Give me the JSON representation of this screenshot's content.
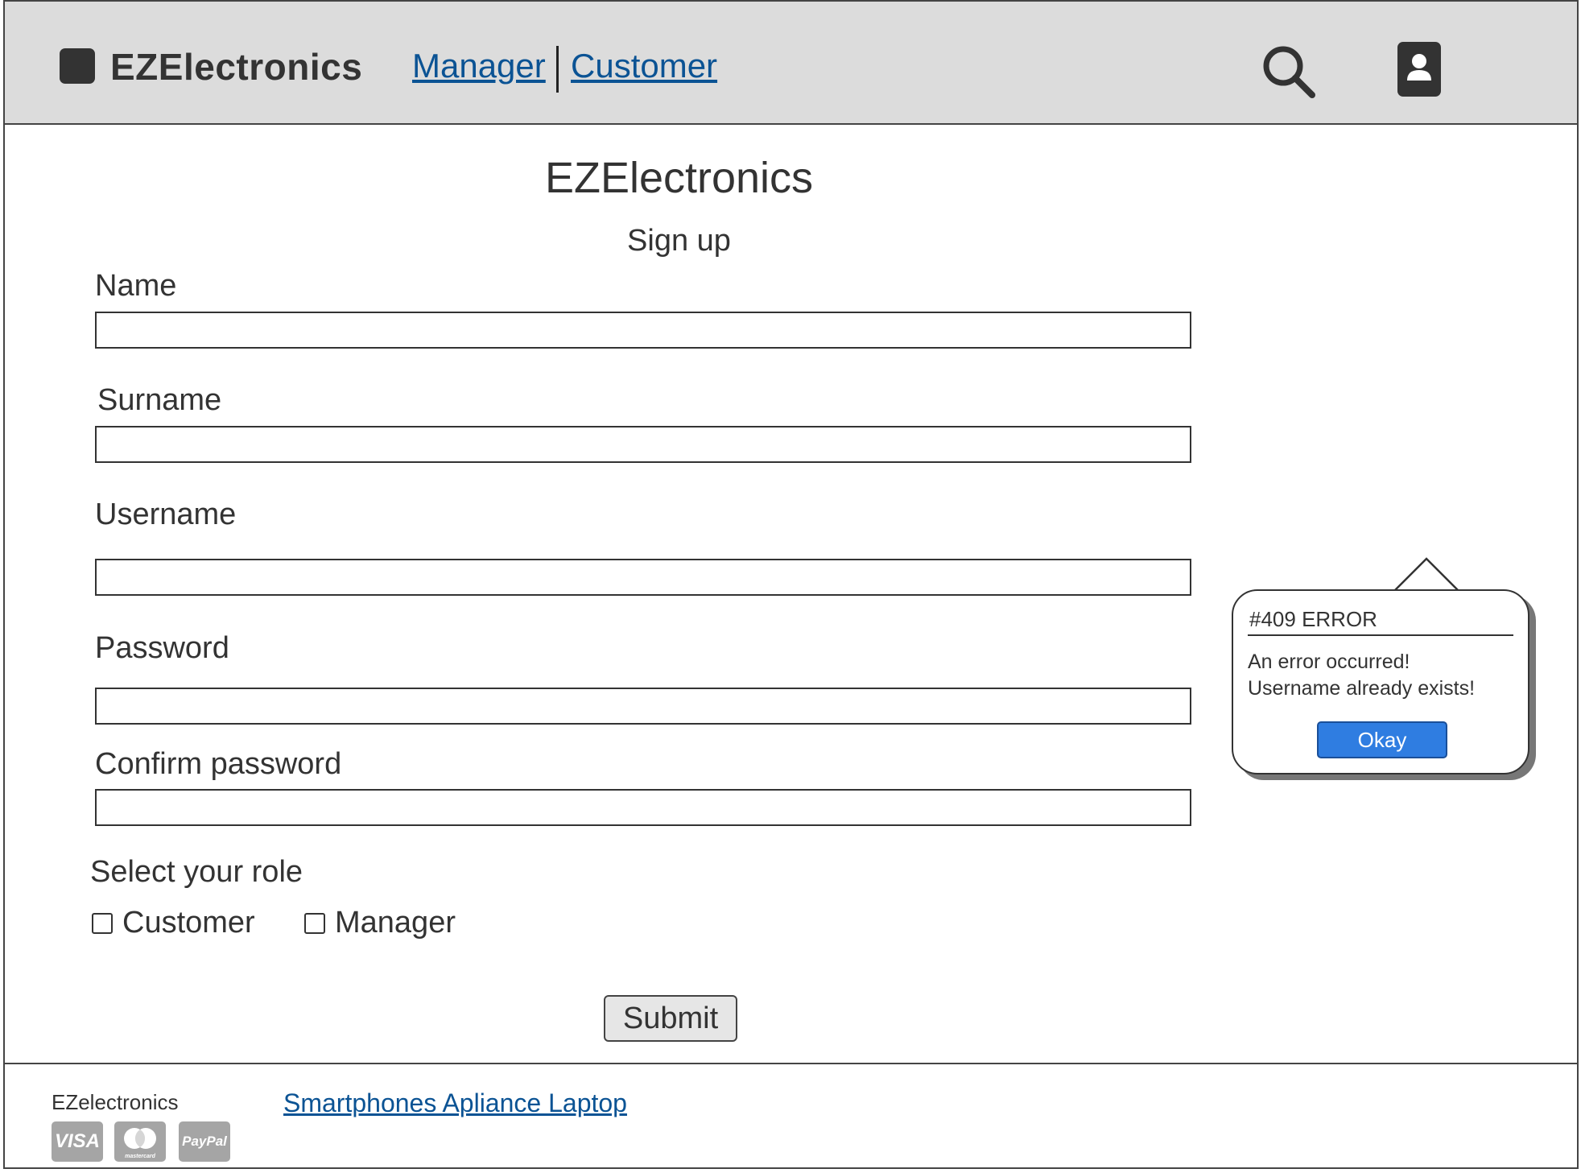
{
  "header": {
    "brand": "EZElectronics",
    "nav": [
      {
        "label": "Manager"
      },
      {
        "label": "Customer"
      }
    ],
    "icons": {
      "search": "search-icon",
      "account": "user-icon"
    }
  },
  "main": {
    "title": "EZElectronics",
    "subtitle": "Sign up",
    "fields": {
      "name": {
        "label": "Name",
        "value": ""
      },
      "surname": {
        "label": "Surname",
        "value": ""
      },
      "username": {
        "label": "Username",
        "value": ""
      },
      "password": {
        "label": "Password",
        "value": ""
      },
      "confirm_password": {
        "label": "Confirm password",
        "value": ""
      }
    },
    "role": {
      "label": "Select your role",
      "options": [
        {
          "label": "Customer",
          "checked": false
        },
        {
          "label": "Manager",
          "checked": false
        }
      ]
    },
    "submit_label": "Submit"
  },
  "error_popup": {
    "title": "#409 ERROR",
    "line1": "An error occurred!",
    "line2": "Username already exists!",
    "button_label": "Okay",
    "button_color": "#2f7de1"
  },
  "footer": {
    "brand": "EZelectronics",
    "links": "Smartphones Apliance Laptop",
    "payment": {
      "visa": "VISA",
      "mastercard_icon": "mastercard-icon",
      "mastercard_text": "mastercard",
      "paypal": "PayPal"
    }
  },
  "colors": {
    "header_bg": "#dcdcdc",
    "link": "#0b5394",
    "text": "#333333"
  }
}
